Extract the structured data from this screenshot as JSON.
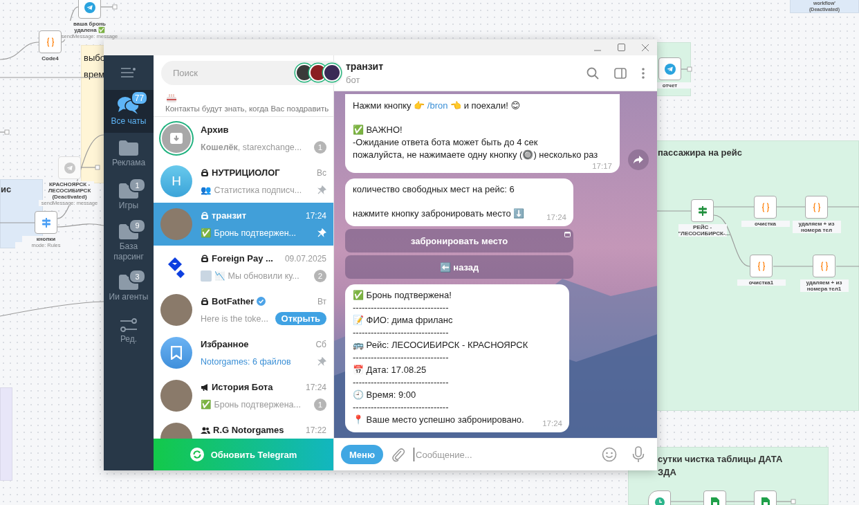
{
  "canvas": {
    "notes": [
      {
        "kind": "heading",
        "color": "#fff5d6",
        "lines": [
          "выбо",
          "врем"
        ]
      },
      {
        "kind": "heading",
        "color": "#dde9f7",
        "lines": [
          "ис"
        ]
      },
      {
        "kind": "plain",
        "color": "#d9f3e4"
      },
      {
        "kind": "heading",
        "color": "#d9f3e4",
        "lines": [
          "пассажира на рейс"
        ]
      },
      {
        "kind": "heading",
        "color": "#d9f3e4",
        "lines": [
          "сутки чистка таблицы ДАТА",
          "ЗДА"
        ]
      },
      {
        "kind": "caption",
        "color": "#dde9f7",
        "lines": [
          "workflow'",
          "(Deactivated)"
        ]
      },
      {
        "kind": "plain",
        "color": "#e8e6f8"
      }
    ],
    "nodes": [
      {
        "kind": "telegram",
        "disabled": false,
        "label": "ваша бронь удалена ✅",
        "subtitle": "sendMessage: message"
      },
      {
        "kind": "code",
        "disabled": false,
        "label": "Code4"
      },
      {
        "kind": "telegram",
        "disabled": true,
        "label": "КРАСНОЯРСК - ЛЕСОСИБИРСК (Deactivated)",
        "subtitle": "sendMessage: message"
      },
      {
        "kind": "switch",
        "disabled": false,
        "label": "кнопки",
        "subtitle": "mode: Rules"
      },
      {
        "kind": "telegram",
        "disabled": false,
        "label": "отчет"
      },
      {
        "kind": "if",
        "disabled": false,
        "label": "РЕЙС - \"ЛЕСОСИБИРСК-..."
      },
      {
        "kind": "code",
        "disabled": false,
        "label": "очистка"
      },
      {
        "kind": "code",
        "disabled": false,
        "label": "удаляем + из номера тел"
      },
      {
        "kind": "code",
        "disabled": false,
        "label": "очистка1"
      },
      {
        "kind": "code",
        "disabled": false,
        "label": "удаляем + из номера тел1"
      },
      {
        "kind": "clock",
        "disabled": false
      },
      {
        "kind": "sheets",
        "disabled": false
      },
      {
        "kind": "sheets",
        "disabled": false
      }
    ]
  },
  "window": {
    "folders": [
      {
        "kind": "chats",
        "label": "Все чаты",
        "badge": "77",
        "selected": true
      },
      {
        "kind": "folder",
        "label": "Реклама",
        "selected": false
      },
      {
        "kind": "folder",
        "label": "Игры",
        "badge": "1",
        "selected": false
      },
      {
        "kind": "folder",
        "label": "База парсинг",
        "badge": "9",
        "selected": false
      },
      {
        "kind": "folder",
        "label": "Ии агенты",
        "badge": "3",
        "selected": false
      },
      {
        "kind": "edit",
        "label": "Ред.",
        "selected": false
      }
    ],
    "search": {
      "placeholder": "Поиск"
    },
    "birthday_banner": {
      "text": "Контакты будут знать, когда Вас поздравить"
    },
    "chats": [
      {
        "kind": "archive",
        "name": "Архив",
        "preview": "**Кошелёк**, starexchange...",
        "badge": "1",
        "pinned": false,
        "selected": false
      },
      {
        "kind": "bot",
        "avatar_letter": "Н",
        "name": "НУТРИЦИОЛОГ",
        "time": "Вс",
        "preview": "👥 Статистика подписч...",
        "pinned": true,
        "selected": false
      },
      {
        "kind": "bot",
        "name": "транзит",
        "time": "17:24",
        "preview": "✅ Бронь подтвержен...",
        "pinned": true,
        "selected": true
      },
      {
        "kind": "bot",
        "name": "Foreign Pay ...",
        "time": "09.07.2025",
        "thumbnail": true,
        "preview": "📉 Мы обновили ку...",
        "badge": "2",
        "pinned": false,
        "selected": false
      },
      {
        "kind": "bot",
        "name": "BotFather",
        "verified": true,
        "time": "Вт",
        "preview": "Here is the toke...",
        "action": "Открыть",
        "pinned": false,
        "selected": false
      },
      {
        "kind": "saved",
        "name": "Избранное",
        "time": "Сб",
        "preview": "Notorgames: 6 файлов",
        "preview_link": true,
        "pinned": true,
        "selected": false
      },
      {
        "kind": "channel",
        "name": "История Бота",
        "time": "17:24",
        "preview": "✅ Бронь подтвержена...",
        "badge": "1",
        "pinned": false,
        "selected": false
      },
      {
        "kind": "group",
        "name": "R.G Notorgames",
        "time": "17:22",
        "pinned": false,
        "selected": false
      }
    ],
    "update_button": "Обновить Telegram",
    "chat": {
      "title": "транзит",
      "subtitle": "бот",
      "messages": [
        {
          "forward": true,
          "time": "17:17",
          "paragraphs": [
            [
              [
                {
                  "kind": "text",
                  "text": "Нажми кнопку 👉 "
                },
                {
                  "kind": "link",
                  "text": "/bron"
                },
                {
                  "kind": "text",
                  "text": " 👈 и поехали! 😊"
                }
              ]
            ],
            [
              [
                {
                  "kind": "text",
                  "text": "✅ ВАЖНО!"
                }
              ],
              [
                {
                  "kind": "text",
                  "text": "-Ожидание ответа бота может быть до 4 сек"
                }
              ],
              [
                {
                  "kind": "text",
                  "text": "пожалуйста, не нажимаете одну кнопку (🔘) несколько раз"
                }
              ]
            ]
          ]
        },
        {
          "forward": false,
          "time": "17:24",
          "paragraphs": [
            [
              [
                {
                  "kind": "text",
                  "text": "количество свободных мест на рейс: 6"
                }
              ]
            ],
            [
              [
                {
                  "kind": "text",
                  "text": "нажмите кнопку забронировать место ⬇️"
                }
              ]
            ]
          ],
          "keyboard": [
            {
              "label": "забронировать место",
              "webapp": true
            },
            {
              "label": "⬅️ назад",
              "webapp": false
            }
          ]
        },
        {
          "forward": false,
          "time": "17:24",
          "paragraphs": [
            [
              [
                {
                  "kind": "text",
                  "text": "✅ Бронь подтвержена!"
                }
              ],
              [
                {
                  "kind": "text",
                  "text": "--------------------------------"
                }
              ],
              [
                {
                  "kind": "text",
                  "text": "📝 ФИО: дима фриланс"
                }
              ],
              [
                {
                  "kind": "text",
                  "text": "--------------------------------"
                }
              ],
              [
                {
                  "kind": "text",
                  "text": "🚌 Рейс: ЛЕСОСИБИРСК - КРАСНОЯРСК"
                }
              ],
              [
                {
                  "kind": "text",
                  "text": "--------------------------------"
                }
              ],
              [
                {
                  "kind": "text",
                  "text": "📅 Дата: 17.08.25"
                }
              ],
              [
                {
                  "kind": "text",
                  "text": "--------------------------------"
                }
              ],
              [
                {
                  "kind": "text",
                  "text": "🕘 Время: 9:00"
                }
              ],
              [
                {
                  "kind": "text",
                  "text": "--------------------------------"
                }
              ],
              [
                {
                  "kind": "text",
                  "text": "📍 Ваше место успешно забронировано."
                }
              ]
            ]
          ]
        }
      ],
      "menu_button": "Меню",
      "composer": {
        "placeholder": "Сообщение..."
      }
    }
  }
}
